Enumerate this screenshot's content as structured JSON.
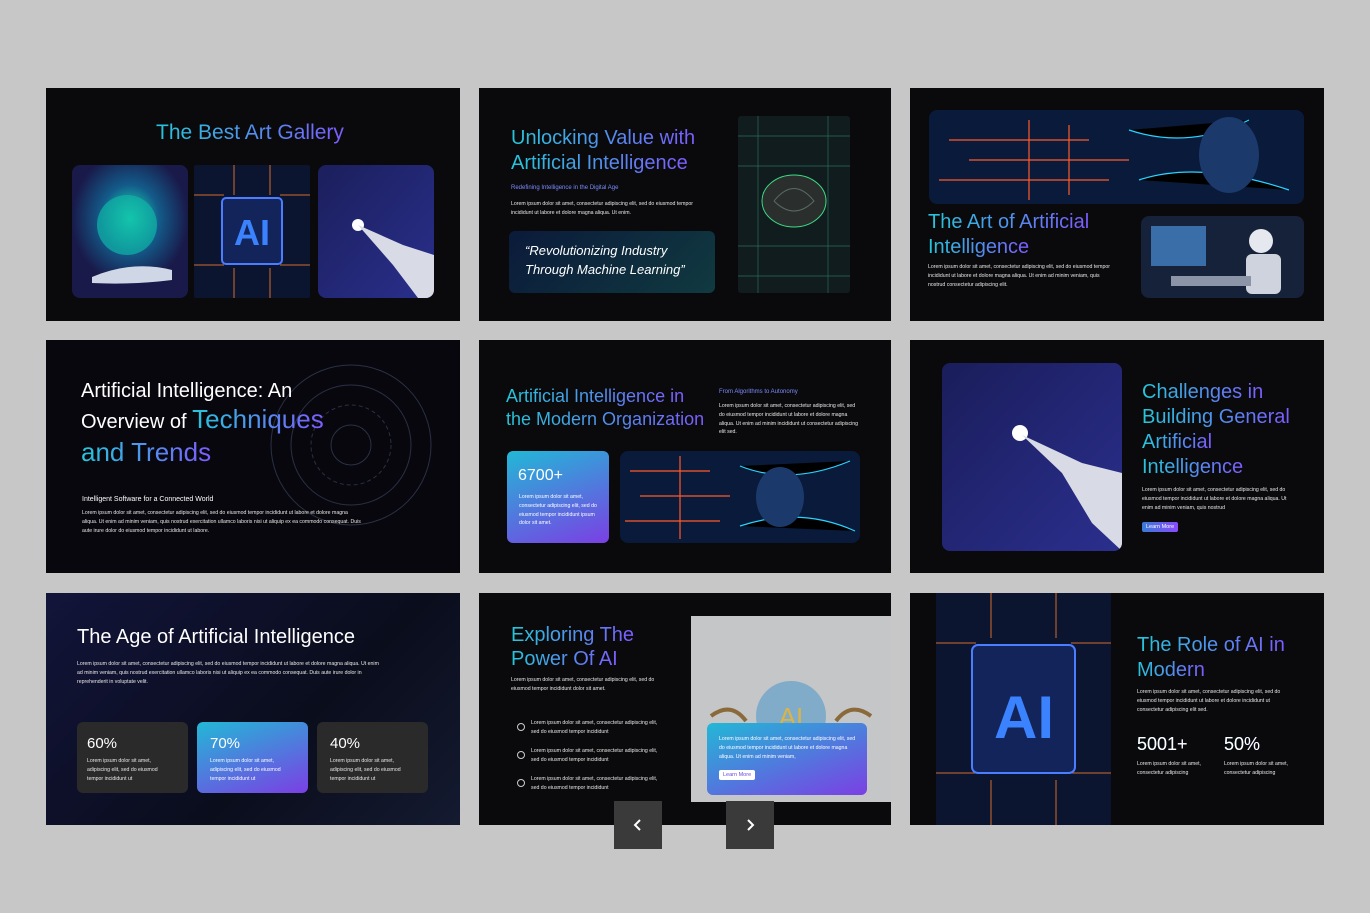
{
  "slides": {
    "s1": {
      "title": "The Best Art Gallery"
    },
    "s2": {
      "title_l1": "Unlocking Value with",
      "title_l2": "Artificial Intelligence",
      "subtitle": "Redefining Intelligence in the Digital Age",
      "body": "Lorem ipsum dolor sit amet, consectetur adipiscing elit, sed do eiusmod tempor incididunt ut labore et dolore magna aliqua. Ut enim.",
      "quote_l1": "“Revolutionizing Industry",
      "quote_l2": "Through Machine Learning”"
    },
    "s3": {
      "title_l1": "The Art of Artificial",
      "title_l2": "Intelligence",
      "body": "Lorem ipsum dolor sit amet, consectetur adipiscing elit, sed do eiusmod tempor incididunt ut labore et dolore magna aliqua. Ut enim ad minim veniam, quis nostrud consectetur adipiscing elit."
    },
    "s4": {
      "title_l1": "Artificial Intelligence: An",
      "title_l2a": "Overview of ",
      "title_l2b": "Techniques",
      "title_l3": "and Trends",
      "subtitle": "Intelligent Software for a Connected World",
      "body": "Lorem ipsum dolor sit amet, consectetur adipiscing elit, sed do eiusmod tempor incididunt ut labore et dolore magna aliqua. Ut enim ad minim veniam, quis nostrud exercitation ullamco laboris nisi ut aliquip ex ea commodo consequat. Duis aute irure dolor do eiusmod tempor incididunt ut labore."
    },
    "s5": {
      "title_l1": "Artificial Intelligence in",
      "title_l2": "the Modern Organization",
      "subtitle": "From Algorithms to Autonomy",
      "body": "Lorem ipsum dolor sit amet, consectetur adipiscing elit, sed do eiusmod tempor incididunt ut labore et dolore magna aliqua. Ut enim ad minim incididunt ut consectetur adipiscing elit sed.",
      "stat": "6700+",
      "stat_body": "Lorem ipsum dolor sit amet, consectetur adipiscing elit, sed do eiusmod tempor incididunt ipsum dolor sit amet."
    },
    "s6": {
      "title_l1": "Challenges in",
      "title_l2": "Building General",
      "title_l3": "Artificial",
      "title_l4": "Intelligence",
      "body": "Lorem ipsum dolor sit amet, consectetur adipiscing elit, sed do eiusmod tempor incididunt ut labore et dolore magna aliqua. Ut enim ad minim veniam, quis nostrud",
      "button": "Learn More"
    },
    "s7": {
      "title": "The Age of Artificial Intelligence",
      "body": "Lorem ipsum dolor sit amet, consectetur adipiscing elit, sed do eiusmod tempor incididunt ut labore et dolore magna aliqua. Ut enim ad minim veniam, quis nostrud exercitation ullamco laboris nisi ut aliquip ex ea commodo consequat. Duis aute irure dolor in reprehenderit in voluptate velit.",
      "cards": [
        {
          "value": "60%",
          "text": "Lorem ipsum dolor sit amet, adipiscing elit, sed do eiusmod tempor incididunt ut"
        },
        {
          "value": "70%",
          "text": "Lorem ipsum dolor sit amet, adipiscing elit, sed do eiusmod tempor incididunt ut"
        },
        {
          "value": "40%",
          "text": "Lorem ipsum dolor sit amet, adipiscing elit, sed do eiusmod tempor incididunt ut"
        }
      ]
    },
    "s8": {
      "title_l1": "Exploring The",
      "title_l2": "Power Of AI",
      "body": "Lorem ipsum dolor sit amet, consectetur adipiscing elit, sed do eiusmod tempor incididunt dolor sit amet.",
      "bullets": [
        "Lorem ipsum dolor sit amet, consectetur adipiscing elit, sed do eiusmod tempor incididunt",
        "Lorem ipsum dolor sit amet, consectetur adipiscing elit, sed do eiusmod tempor incididunt",
        "Lorem ipsum dolor sit amet, consectetur adipiscing elit, sed do eiusmod tempor incididunt"
      ],
      "card_body": "Lorem ipsum dolor sit amet, consectetur adipiscing elit, sed do eiusmod tempor incididunt ut labore et dolore magna aliqua. Ut enim ad minim veniam,",
      "button": "Learn More"
    },
    "s9": {
      "title_l1": "The Role of AI in",
      "title_l2": "Modern",
      "body": "Lorem ipsum dolor sit amet, consectetur adipiscing elit, sed do eiusmod tempor incididunt ut labore et dolore incididunt ut consectetur adipiscing elit sed.",
      "stat1": "5001+",
      "stat1_text": "Lorem ipsum dolor sit amet, consectetur adipiscing",
      "stat2": "50%",
      "stat2_text": "Lorem ipsum dolor sit amet, consectetur adipiscing"
    }
  },
  "nav": {
    "prev_icon": "chevron-left-icon",
    "next_icon": "chevron-right-icon"
  },
  "colors": {
    "background": "#c7c7c7",
    "slide": "#0a0a0c",
    "accent_cyan": "#26c6da",
    "accent_purple": "#7c5cff"
  }
}
